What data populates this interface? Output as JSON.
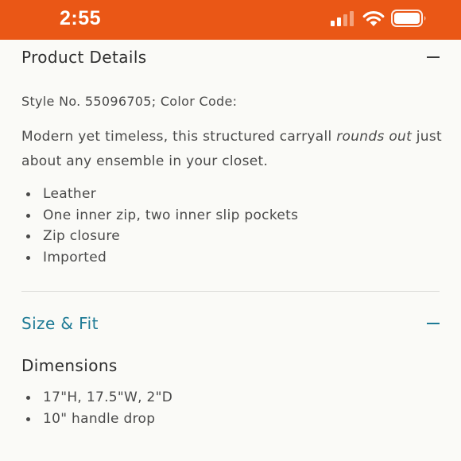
{
  "status_bar": {
    "time": "2:55",
    "background": "#ea5716"
  },
  "product_details": {
    "title": "Product Details",
    "style_line": "Style No. 55096705; Color Code:",
    "description_before": "Modern yet timeless, this structured carryall ",
    "description_emphasis": "rounds out",
    "description_after": " just about any ensemble in your closet.",
    "features": [
      "Leather",
      "One inner zip, two inner slip pockets",
      "Zip closure",
      "Imported"
    ]
  },
  "size_fit": {
    "title": "Size & Fit",
    "accent_color": "#1d7a95",
    "dimensions_title": "Dimensions",
    "dimensions": [
      "17\"H, 17.5\"W, 2\"D",
      "10\" handle drop"
    ]
  }
}
